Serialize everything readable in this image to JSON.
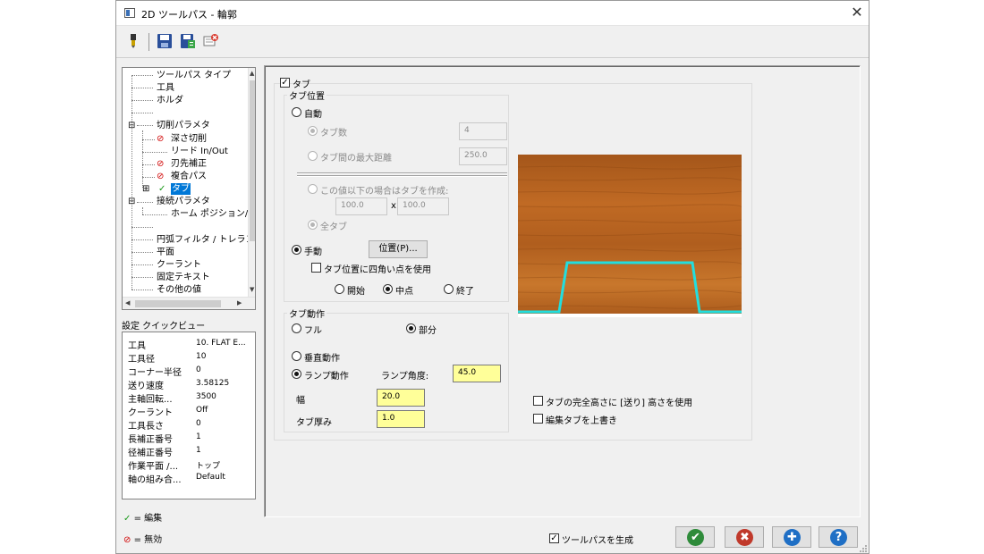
{
  "window": {
    "title": "2D ツールパス - 輪郭",
    "close_glyph": "✕"
  },
  "toolbar": {
    "icons": [
      "tool-icon",
      "save-icon",
      "save-as-icon",
      "delete-icon"
    ]
  },
  "tree": {
    "items": [
      {
        "label": "ツールパス タイプ"
      },
      {
        "label": "工具"
      },
      {
        "label": "ホルダ"
      },
      {
        "label": ""
      },
      {
        "label": "切削パラメタ",
        "expander": "⊟"
      },
      {
        "label": "深さ切削",
        "status": "disabled"
      },
      {
        "label": "リード In/Out"
      },
      {
        "label": "刃先補正",
        "status": "disabled"
      },
      {
        "label": "複合パス",
        "status": "disabled"
      },
      {
        "label": "タブ",
        "status": "edited",
        "expander": "⊞",
        "selected": true
      },
      {
        "label": "接続パラメタ",
        "expander": "⊟"
      },
      {
        "label": "ホーム ポジション/参照"
      },
      {
        "label": ""
      },
      {
        "label": "円弧フィルタ / トレランス"
      },
      {
        "label": "平面"
      },
      {
        "label": "クーラント"
      },
      {
        "label": "固定テキスト"
      },
      {
        "label": "その他の値"
      }
    ],
    "scroll_up": "▲",
    "scroll_down": "▼",
    "scroll_left": "◀",
    "scroll_right": "▶"
  },
  "quickview": {
    "label": "設定 クイックビュー",
    "rows": [
      {
        "key": "工具",
        "value": "10. FLAT E..."
      },
      {
        "key": "工具径",
        "value": "10"
      },
      {
        "key": "コーナー半径",
        "value": "0"
      },
      {
        "key": "送り速度",
        "value": "3.58125"
      },
      {
        "key": "主軸回転...",
        "value": "3500"
      },
      {
        "key": "クーラント",
        "value": "Off"
      },
      {
        "key": "工具長さ",
        "value": "0"
      },
      {
        "key": "長補正番号",
        "value": "1"
      },
      {
        "key": "径補正番号",
        "value": "1"
      },
      {
        "key": "作業平面 /...",
        "value": "トップ"
      },
      {
        "key": "軸の組み合...",
        "value": "Default"
      }
    ]
  },
  "legend": {
    "edited_symbol": "✓",
    "edited_label": "= 編集",
    "disabled_symbol": "⊘",
    "disabled_label": "= 無効"
  },
  "tabs_section": {
    "enable_label": "タブ",
    "enable_checked": true,
    "position_group": {
      "title": "タブ位置",
      "auto_label": "自動",
      "tab_count_label": "タブ数",
      "tab_count_value": "4",
      "max_distance_label": "タブ間の最大距離",
      "max_distance_value": "250.0",
      "size_condition_label": "この値以下の場合はタブを作成:",
      "size_x_value": "100.0",
      "size_x_sep": "x",
      "size_y_value": "100.0",
      "all_tabs_label": "全タブ",
      "manual_label": "手動",
      "position_button": "位置(P)...",
      "four_corners_label": "タブ位置に四角い点を使用",
      "start_label": "開始",
      "mid_label": "中点",
      "end_label": "終了"
    },
    "motion_group": {
      "title": "タブ動作",
      "full_label": "フル",
      "partial_label": "部分",
      "vertical_label": "垂直動作",
      "ramp_label": "ランプ動作",
      "ramp_angle_label": "ランプ角度:",
      "ramp_angle_value": "45.0",
      "width_label": "幅",
      "width_value": "20.0",
      "thickness_label": "タブ厚み",
      "thickness_value": "1.0"
    },
    "full_height_label": "タブの完全高さに [送り] 高さを使用",
    "overwrite_label": "編集タブを上書き"
  },
  "footer": {
    "generate_label": "ツールパスを生成",
    "generate_checked": true,
    "ok_glyph": "✔",
    "cancel_glyph": "✖",
    "add_glyph": "✚",
    "help_glyph": "?",
    "colors": {
      "ok": "#2e8b3a",
      "cancel": "#c0392b",
      "add": "#1f6fc5",
      "help": "#1f6fc5"
    }
  },
  "preview": {
    "outline_color": "#22dede",
    "wood_color": "#b5621e"
  }
}
